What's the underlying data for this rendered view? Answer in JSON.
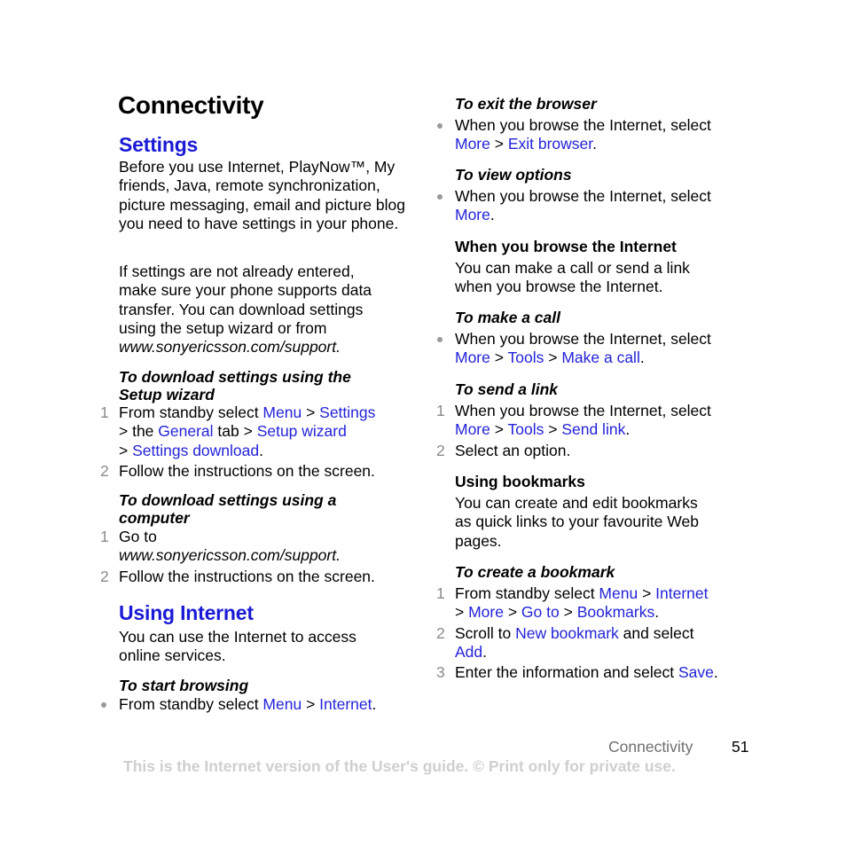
{
  "page": {
    "title": "Connectivity",
    "footer": {
      "section": "Connectivity",
      "page_number": "51",
      "note": "This is the Internet version of the User's guide. © Print only for private use."
    }
  },
  "settings": {
    "heading": "Settings",
    "intro": "Before you use Internet, PlayNow™, My friends, Java, remote synchronization, picture messaging, email and picture blog you need to have settings in your phone.",
    "para2_lines": [
      "If settings are not already entered,",
      "make sure your phone supports data",
      "transfer. You can download settings",
      "using the setup wizard or from"
    ],
    "para2_url": "www.sonyericsson.com/support.",
    "wizard": {
      "heading_lines": [
        "To download settings using the",
        "Setup wizard"
      ],
      "steps": [
        {
          "num": "1",
          "t1": "From standby select ",
          "l1": "Menu",
          "t2": " > ",
          "l2": "Settings",
          "t3": "> the ",
          "l3": "General",
          "t4": " tab > ",
          "l4": "Setup wizard",
          "t5": "> ",
          "l5": "Settings download",
          "t6": "."
        },
        {
          "num": "2",
          "text": "Follow the instructions on the screen."
        }
      ]
    },
    "computer": {
      "heading_lines": [
        "To download settings using a",
        "computer"
      ],
      "steps": [
        {
          "num": "1",
          "text": "Go to",
          "url": "www.sonyericsson.com/support."
        },
        {
          "num": "2",
          "text": "Follow the instructions on the screen."
        }
      ]
    }
  },
  "using_internet": {
    "heading": "Using Internet",
    "intro_lines": [
      "You can use the Internet to access",
      "online services."
    ],
    "start": {
      "heading": "To start browsing",
      "t1": "From standby select ",
      "l1": "Menu",
      "t2": " > ",
      "l2": "Internet",
      "t3": "."
    },
    "exit": {
      "heading": "To exit the browser",
      "t1": "When you browse the Internet, select",
      "l1": "More",
      "t2": " > ",
      "l2": "Exit browser",
      "t3": "."
    },
    "options": {
      "heading": "To view options",
      "t1": "When you browse the Internet, select",
      "l1": "More",
      "t2": "."
    },
    "when_browse": {
      "heading": "When you browse the Internet",
      "lines": [
        "You can make a call or send a link",
        "when you browse the Internet."
      ]
    },
    "call": {
      "heading": "To make a call",
      "t1": "When you browse the Internet, select",
      "l1": "More",
      "t2": " > ",
      "l2": "Tools",
      "t3": " > ",
      "l3": "Make a call",
      "t4": "."
    },
    "send_link": {
      "heading": "To send a link",
      "steps": [
        {
          "num": "1",
          "t1": "When you browse the Internet, select",
          "l1": "More",
          "t2": " > ",
          "l2": "Tools",
          "t3": " > ",
          "l3": "Send link",
          "t4": "."
        },
        {
          "num": "2",
          "text": "Select an option."
        }
      ]
    },
    "bookmarks": {
      "heading": "Using bookmarks",
      "lines": [
        "You can create and edit bookmarks",
        "as quick links to your favourite Web",
        "pages."
      ]
    },
    "create_bookmark": {
      "heading": "To create a bookmark",
      "steps": [
        {
          "num": "1",
          "t1": "From standby select ",
          "l1": "Menu",
          "t2": " > ",
          "l2": "Internet",
          "t3": "> ",
          "l3": "More",
          "t4": " > ",
          "l4": "Go to",
          "t5": " > ",
          "l5": "Bookmarks",
          "t6": "."
        },
        {
          "num": "2",
          "t1": "Scroll to ",
          "l1": "New bookmark",
          "t2": " and select",
          "l2": "Add",
          "t3": "."
        },
        {
          "num": "3",
          "t1": "Enter the information and select ",
          "l1": "Save",
          "t2": "."
        }
      ]
    }
  }
}
